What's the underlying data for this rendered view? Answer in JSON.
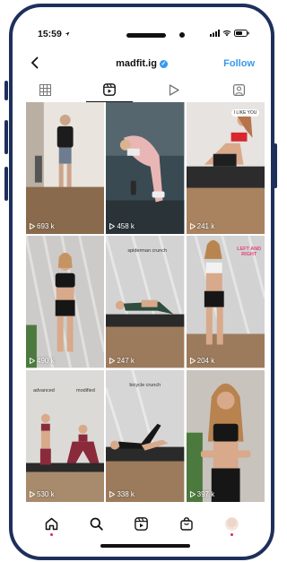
{
  "status_bar": {
    "time": "15:59"
  },
  "header": {
    "username": "madfit.ig",
    "follow_label": "Follow"
  },
  "tabs": [
    "grid-icon",
    "reels-icon",
    "play-icon",
    "tagged-icon"
  ],
  "posts": [
    {
      "views": "693 k",
      "bg": [
        "#7a6a5c",
        "#c9bfb3"
      ]
    },
    {
      "views": "458 k",
      "bg": [
        "#2f3e46",
        "#5f6b72"
      ]
    },
    {
      "views": "241 k",
      "bg": [
        "#d9d4cf",
        "#a89c92"
      ],
      "overlay": "I LIKE YOU"
    },
    {
      "views": "490 k",
      "bg": [
        "#c8c6c4",
        "#8c8986"
      ]
    },
    {
      "views": "247 k",
      "bg": [
        "#d8d8d8",
        "#bebebe"
      ],
      "overlay": "spiderman crunch"
    },
    {
      "views": "204 k",
      "bg": [
        "#d0d0d0",
        "#b3b3b3"
      ],
      "overlay": "LEFT AND RIGHT"
    },
    {
      "views": "530 k",
      "bg": [
        "#d2d0cc",
        "#a9a6a1"
      ],
      "overlay": "advanced",
      "overlay2": "modified"
    },
    {
      "views": "338 k",
      "bg": [
        "#d4d4d4",
        "#b0b0b0"
      ],
      "overlay": "bicycle crunch"
    },
    {
      "views": "397 k",
      "bg": [
        "#a49d96",
        "#6e6861"
      ]
    }
  ],
  "nav": [
    "home-icon",
    "search-icon",
    "reels-icon",
    "shop-icon",
    "profile-avatar"
  ]
}
